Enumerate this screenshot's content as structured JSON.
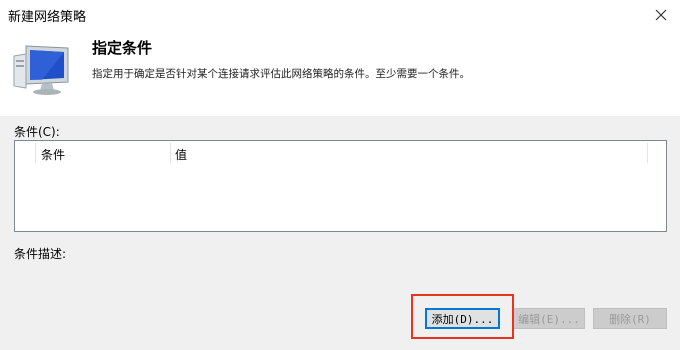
{
  "window": {
    "title": "新建网络策略",
    "close_icon": "close-icon"
  },
  "header": {
    "icon": "network-monitor-icon",
    "title": "指定条件",
    "description": "指定用于确定是否针对某个连接请求评估此网络策略的条件。至少需要一个条件。"
  },
  "conditions": {
    "label": "条件(C):",
    "columns": [
      "条件",
      "值"
    ],
    "rows": []
  },
  "description_label": "条件描述:",
  "buttons": {
    "add": "添加(D)...",
    "edit": "编辑(E)...",
    "delete": "删除(R)"
  },
  "colors": {
    "highlight": "#e8341c",
    "default_button_border": "#0078d7",
    "panel_bg": "#f0f0f0"
  }
}
